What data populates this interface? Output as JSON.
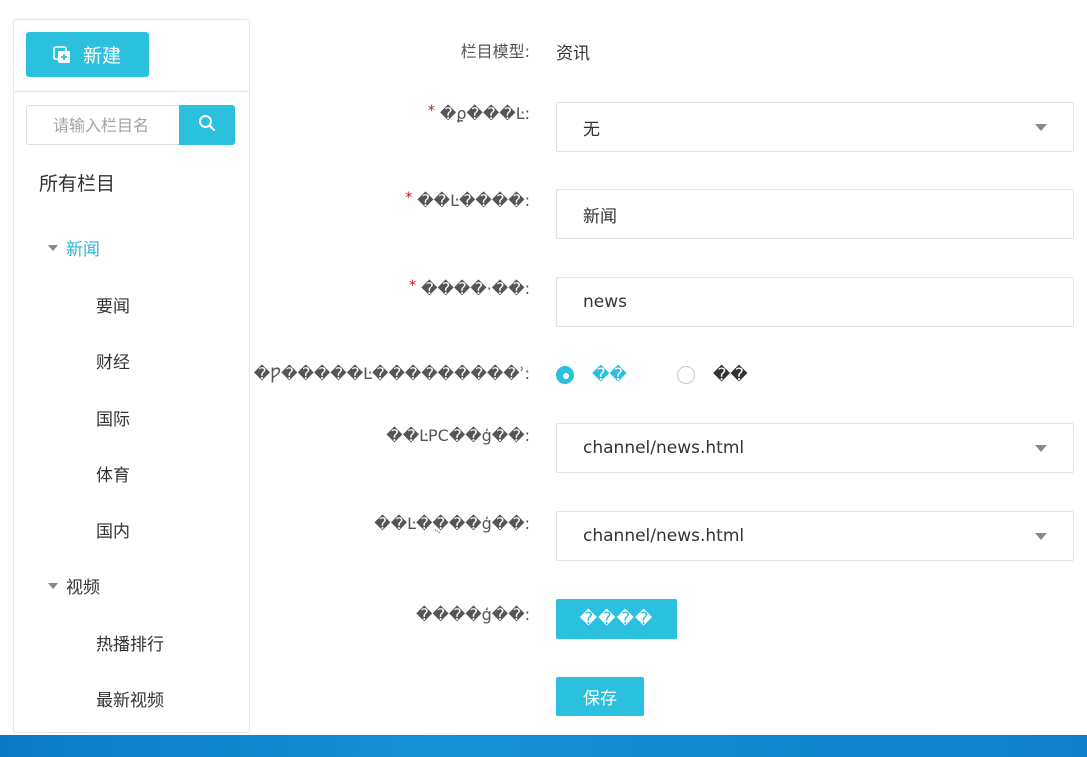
{
  "sidebar": {
    "new_button_label": "新建",
    "search_placeholder": "请输入栏目名",
    "tree_root": "所有栏目",
    "groups": [
      {
        "label": "新闻",
        "children": [
          "要闻",
          "财经",
          "国际",
          "体育",
          "国内"
        ]
      },
      {
        "label": "视频",
        "children": [
          "热播排行",
          "最新视频"
        ]
      }
    ]
  },
  "form": {
    "model_label": "栏目模型:",
    "model_value": "资讯",
    "parent_label": "�ϼ���Ŀ:",
    "parent_value": "无",
    "name_label": "��Ŀ����:",
    "name_value": "新闻",
    "path_label": "����·��:",
    "path_value": "news",
    "nav_label": "�Ƿ�����Ŀ���������ʾ:",
    "nav_options": [
      "��",
      "��"
    ],
    "pc_template_label": "��ĿPC��ģ��:",
    "pc_template_value": "channel/news.html",
    "mobile_template_label": "��Ŀ�ֻ���ģ��:",
    "mobile_template_value": "channel/news.html",
    "image_label": "����ģ��:",
    "upload_label": "����",
    "save_label": "保存"
  },
  "colors": {
    "accent": "#2ac0de",
    "required": "#e00000",
    "taskbar": "#0f7fcc"
  }
}
